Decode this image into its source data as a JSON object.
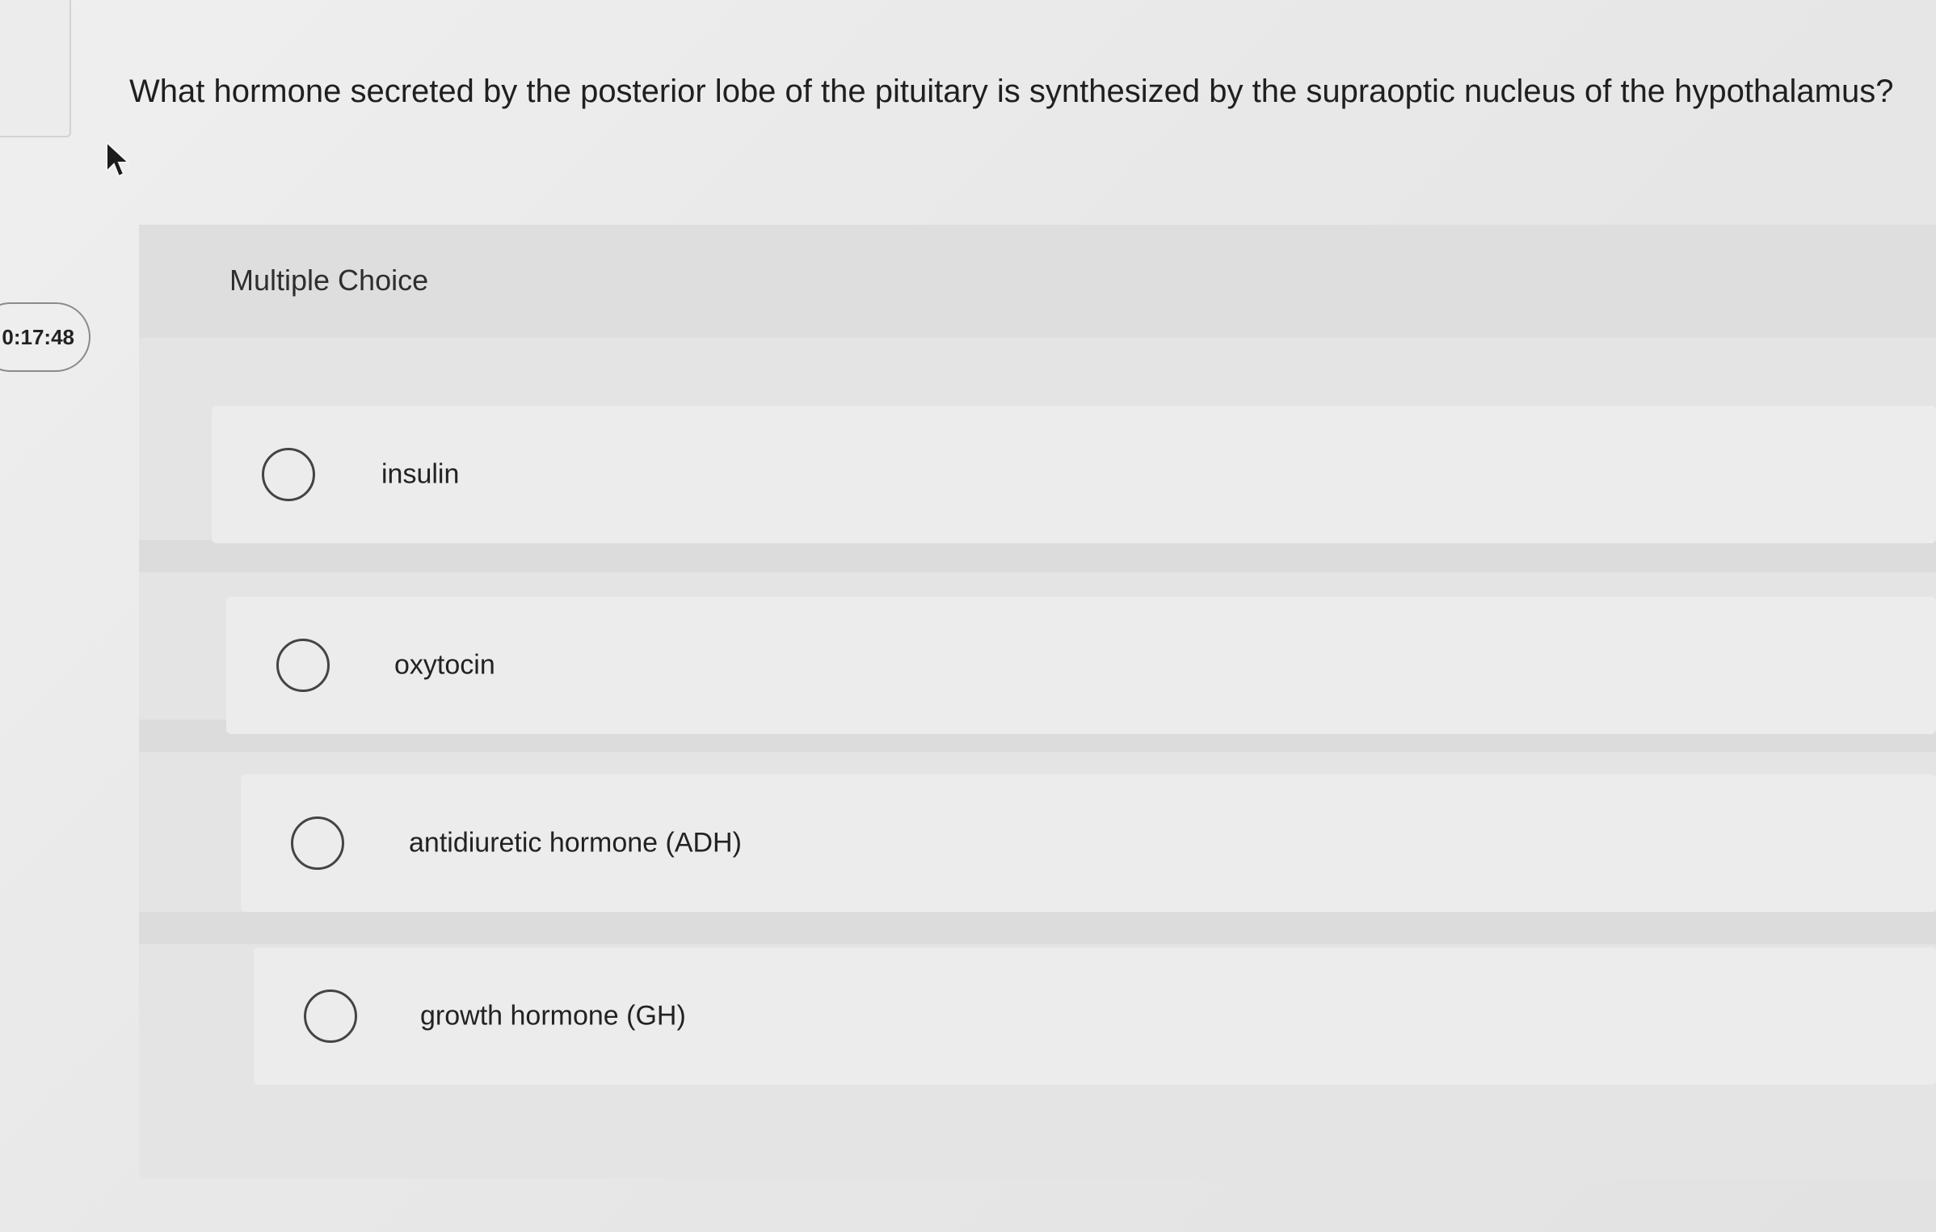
{
  "question": {
    "text": "What hormone secreted by the posterior lobe of the pituitary is synthesized by the supraoptic nucleus of the hypothalamus?"
  },
  "timer": {
    "value": "0:17:48"
  },
  "question_type": {
    "label": "Multiple Choice"
  },
  "options": [
    {
      "label": "insulin"
    },
    {
      "label": "oxytocin"
    },
    {
      "label": "antidiuretic hormone (ADH)"
    },
    {
      "label": "growth hormone (GH)"
    }
  ],
  "colors": {
    "background": "#e9e9e9",
    "panel": "#e4e4e4",
    "option": "#ececec",
    "text": "#222222",
    "radio_border": "#444444"
  }
}
